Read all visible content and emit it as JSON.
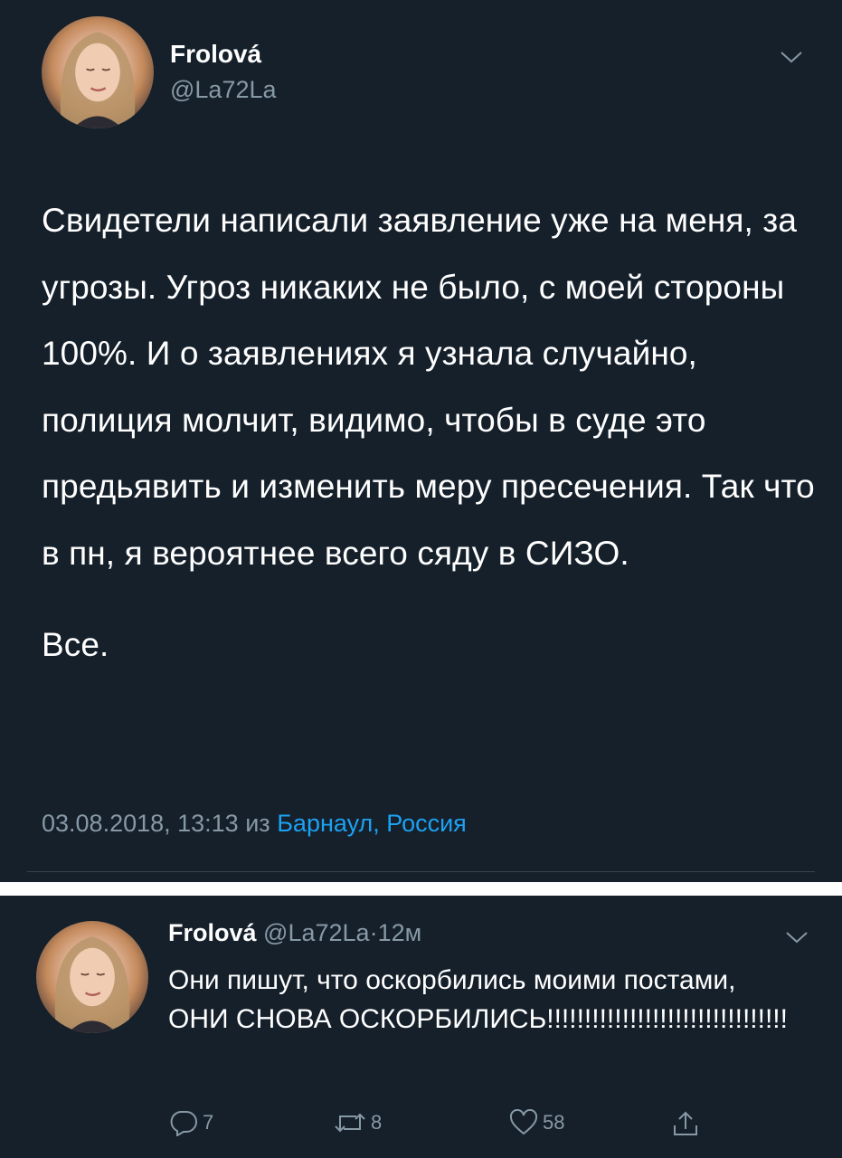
{
  "main_tweet": {
    "author_name": "Frolová",
    "author_handle": "@La72La",
    "avatar_icon": "profile-photo",
    "text_paragraph_1": "Свидетели написали заявление уже на меня, за угрозы. Угроз никаких не было, с моей стороны 100%. И о заявлениях я узнала случайно, полиция молчит, видимо, чтобы в суде это предьявить и изменить меру пресечения. Так что в пн, я вероятнее всего сяду в СИЗО.",
    "text_paragraph_2": "Все.",
    "timestamp": "03.08.2018, 13:13",
    "from_word": "из",
    "location": "Барнаул, Россия"
  },
  "reply_tweet": {
    "author_name": "Frolová",
    "author_handle": "@La72La",
    "separator": "·",
    "age": "12м",
    "text": "Они пишут, что оскорбились моими постами, ОНИ СНОВА ОСКОРБИЛИСЬ!!!!!!!!!!!!!!!!!!!!!!!!!!!!!!!!",
    "actions": {
      "reply_count": "7",
      "retweet_count": "8",
      "like_count": "58",
      "share_icon": "share-icon"
    }
  },
  "colors": {
    "background": "#15202b",
    "text_primary": "#ffffff",
    "text_secondary": "#8899a6",
    "link": "#1da1f2",
    "divider": "#38444d"
  }
}
